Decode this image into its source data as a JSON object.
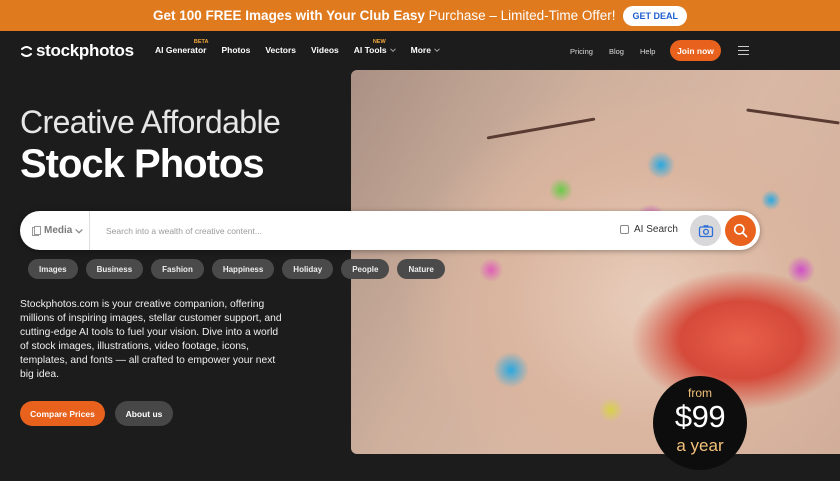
{
  "promo": {
    "text_bold": "Get 100 FREE Images with Your Club Easy",
    "text_thin": "Purchase – Limited-Time Offer!",
    "button": "GET DEAL"
  },
  "nav": {
    "logo": "stockphotos",
    "items": [
      {
        "label": "AI Generator",
        "tag": "BETA"
      },
      {
        "label": "Photos"
      },
      {
        "label": "Vectors"
      },
      {
        "label": "Videos"
      },
      {
        "label": "AI Tools",
        "tag": "NEW"
      },
      {
        "label": "More"
      }
    ],
    "right_links": [
      "Pricing",
      "Blog",
      "Help"
    ],
    "join": "Join now"
  },
  "hero": {
    "headline_light": "Creative Affordable",
    "headline_bold": "Stock Photos",
    "description": "Stockphotos.com is your creative companion, offering millions of inspiring images, stellar customer support, and cutting-edge AI tools to fuel your vision. Dive into a world of stock images, illustrations, video footage, icons, templates, and fonts — all crafted to empower your next big idea.",
    "compare_button": "Compare Prices",
    "about_button": "About us"
  },
  "search": {
    "media_label": "Media",
    "placeholder": "Search into a wealth of creative content...",
    "ai_search": "AI Search"
  },
  "chips": [
    "Images",
    "Business",
    "Fashion",
    "Happiness",
    "Holiday",
    "People",
    "Nature"
  ],
  "price_badge": {
    "from": "from",
    "amount": "$99",
    "per": "a year"
  },
  "colors": {
    "accent": "#e8621e",
    "promo": "#e07a1f",
    "background": "#1c1c1c"
  }
}
